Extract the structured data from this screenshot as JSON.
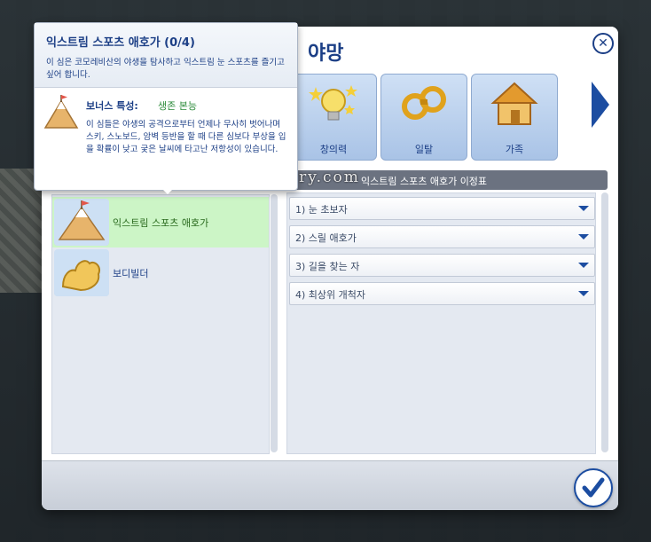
{
  "title": "야망",
  "categories": [
    {
      "label": "창의력",
      "icon": "lightbulb-icon"
    },
    {
      "label": "일탈",
      "icon": "handcuffs-icon"
    },
    {
      "label": "가족",
      "icon": "house-icon"
    }
  ],
  "traits": [
    {
      "label": "익스트림 스포츠 애호가",
      "icon": "mountain-icon",
      "selected": true
    },
    {
      "label": "보디빌더",
      "icon": "bicep-icon",
      "selected": false
    }
  ],
  "milestone_header": "익스트림 스포츠 애호가 이정표",
  "milestones": [
    {
      "label": "1) 눈 초보자"
    },
    {
      "label": "2) 스릴 애호가"
    },
    {
      "label": "3) 길을 찾는 자"
    },
    {
      "label": "4) 최상위 개척자"
    }
  ],
  "tooltip": {
    "title": "익스트림 스포츠 애호가 (0/4)",
    "description": "이 심은 코모레비산의 야생을 탐사하고 익스트림 눈 스포츠를 즐기고 싶어 합니다.",
    "bonus_label": "보너스 특성:",
    "bonus_name": "생존 본능",
    "bonus_description": "이 심들은 야생의 공격으로부터 언제나 무사히 벗어나며 스키, 스노보드, 암벽 등반을 할 때 다른 심보다 부상을 입을 확률이 낮고 궂은 날씨에 타고난 저항성이 있습니다."
  },
  "watermark": "foggy.tistory.com",
  "colors": {
    "accent": "#1c3f86",
    "selected_bg": "#ccf5c6",
    "bonus_green": "#2a8a38"
  }
}
